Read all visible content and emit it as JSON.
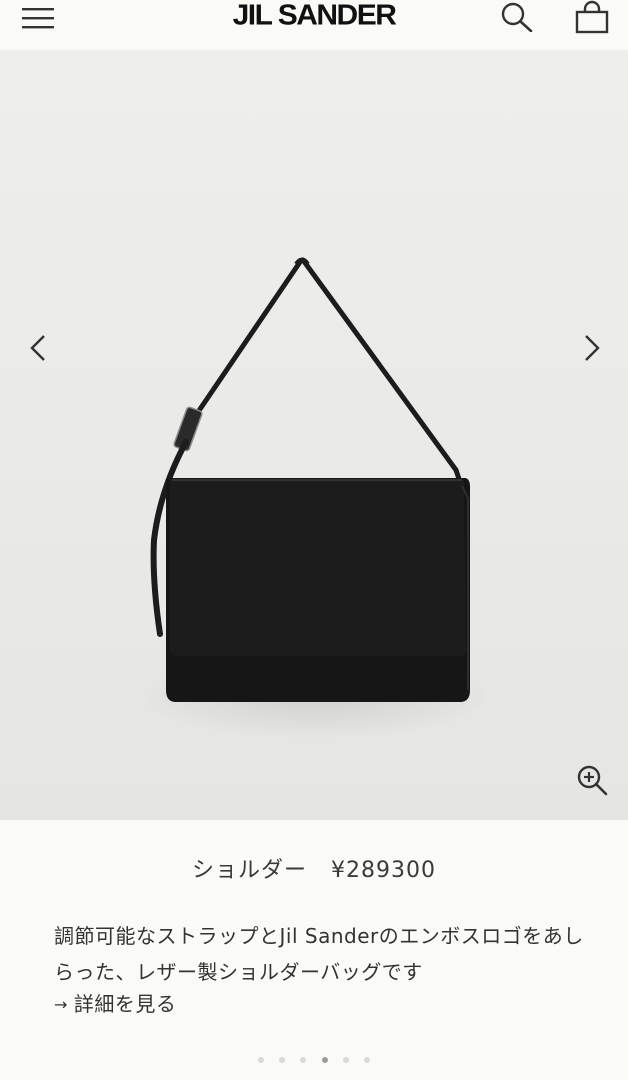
{
  "header": {
    "brand": "JIL SANDER",
    "icons": [
      "menu-icon",
      "search-icon",
      "shopping-bag-icon"
    ]
  },
  "gallery": {
    "controls": [
      "chevron-left-icon",
      "chevron-right-icon",
      "zoom-in-icon"
    ],
    "slide_count": 6,
    "active_slide": 4
  },
  "product": {
    "name": "ショルダー",
    "price": "¥289300",
    "description": "調節可能なストラップとJil Sanderのエンボスロゴをあしらった、レザー製ショルダーバッグです",
    "details_link": "詳細を見る"
  },
  "colors": {
    "background": "#fafaf6",
    "gallery_bg": "#ebebe9",
    "bag": "#1a1a1a"
  }
}
